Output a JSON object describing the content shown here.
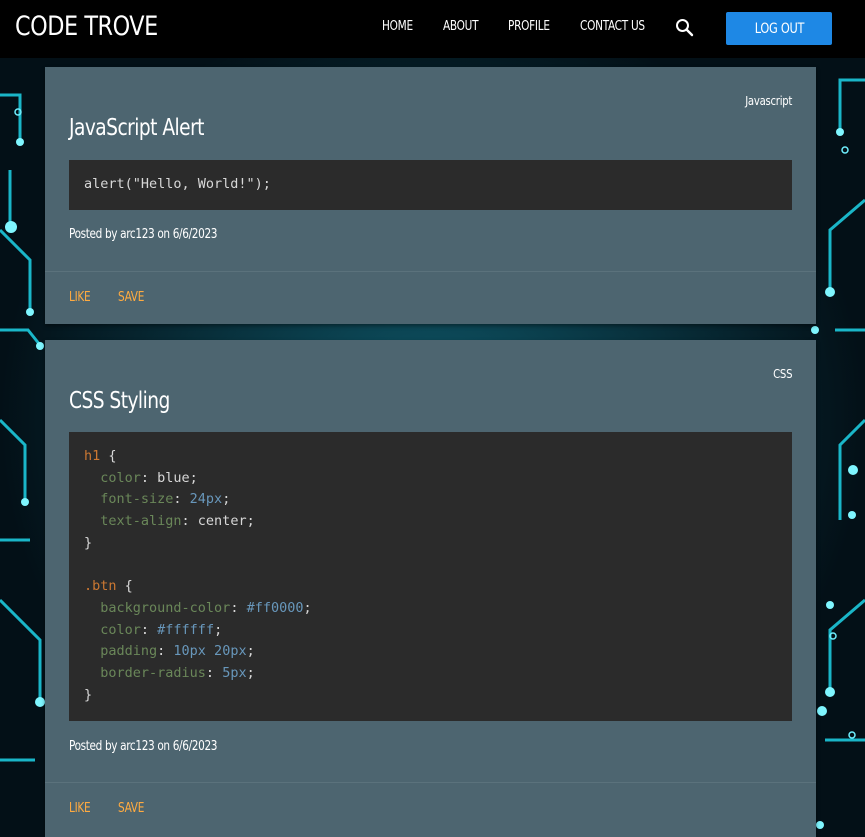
{
  "header": {
    "brand": "CODE TROVE",
    "nav": [
      "HOME",
      "ABOUT",
      "PROFILE",
      "CONTACT US"
    ],
    "logout_label": "LOG OUT"
  },
  "posts": [
    {
      "language": "Javascript",
      "title": "JavaScript Alert",
      "code": "alert(\"Hello, World!\");",
      "meta": "Posted by arc123 on 6/6/2023",
      "like_label": "LIKE",
      "save_label": "SAVE"
    },
    {
      "language": "CSS",
      "title": "CSS Styling",
      "code_lines": [
        [
          {
            "t": "h1",
            "c": "sel"
          },
          {
            "t": " {",
            "c": "plain"
          }
        ],
        [
          {
            "t": "  color",
            "c": "prop"
          },
          {
            "t": ": blue;",
            "c": "plain"
          }
        ],
        [
          {
            "t": "  font-size",
            "c": "prop"
          },
          {
            "t": ": ",
            "c": "plain"
          },
          {
            "t": "24px",
            "c": "num"
          },
          {
            "t": ";",
            "c": "plain"
          }
        ],
        [
          {
            "t": "  text-align",
            "c": "prop"
          },
          {
            "t": ": center;",
            "c": "plain"
          }
        ],
        [
          {
            "t": "}",
            "c": "plain"
          }
        ],
        [
          {
            "t": "",
            "c": "plain"
          }
        ],
        [
          {
            "t": ".btn",
            "c": "sel"
          },
          {
            "t": " {",
            "c": "plain"
          }
        ],
        [
          {
            "t": "  background-color",
            "c": "prop"
          },
          {
            "t": ": ",
            "c": "plain"
          },
          {
            "t": "#ff0000",
            "c": "num"
          },
          {
            "t": ";",
            "c": "plain"
          }
        ],
        [
          {
            "t": "  color",
            "c": "prop"
          },
          {
            "t": ": ",
            "c": "plain"
          },
          {
            "t": "#ffffff",
            "c": "num"
          },
          {
            "t": ";",
            "c": "plain"
          }
        ],
        [
          {
            "t": "  padding",
            "c": "prop"
          },
          {
            "t": ": ",
            "c": "plain"
          },
          {
            "t": "10px 20px",
            "c": "num"
          },
          {
            "t": ";",
            "c": "plain"
          }
        ],
        [
          {
            "t": "  border-radius",
            "c": "prop"
          },
          {
            "t": ": ",
            "c": "plain"
          },
          {
            "t": "5px",
            "c": "num"
          },
          {
            "t": ";",
            "c": "plain"
          }
        ],
        [
          {
            "t": "}",
            "c": "plain"
          }
        ]
      ],
      "meta": "Posted by arc123 on 6/6/2023",
      "like_label": "LIKE",
      "save_label": "SAVE"
    }
  ],
  "colors": {
    "header_bg": "#000000",
    "card_bg": "#4d6570",
    "code_bg": "#2b2b2b",
    "action": "#ffab40",
    "logout_bg": "#1e88e5"
  }
}
